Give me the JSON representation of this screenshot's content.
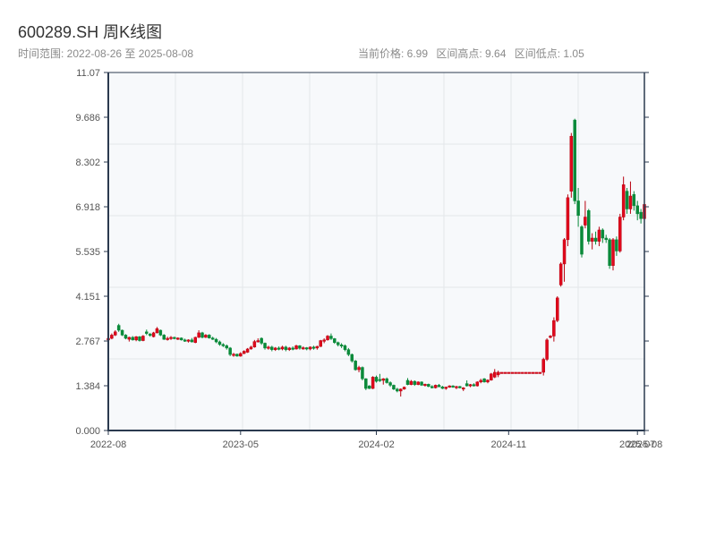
{
  "header": {
    "title": "600289.SH 周K线图",
    "range_text": "时间范围: 2022-08-26 至 2025-08-08",
    "current_price": "当前价格: 6.99",
    "range_high": "区间高点: 9.64",
    "range_low": "区间低点: 1.05"
  },
  "chart_data": {
    "type": "candlestick",
    "title": "600289.SH 周K线图",
    "xlabel": "",
    "ylabel": "",
    "frequency": "weekly",
    "date_range": [
      "2022-08-26",
      "2025-08-08"
    ],
    "ylim": [
      0,
      11.07
    ],
    "y_ticks": [
      "0.000",
      "1.384",
      "2.767",
      "4.151",
      "5.535",
      "6.918",
      "8.302",
      "9.686",
      "11.07"
    ],
    "x_ticks": [
      {
        "label": "2022-08",
        "index": 0
      },
      {
        "label": "2023-05",
        "index": 38
      },
      {
        "label": "2024-02",
        "index": 77
      },
      {
        "label": "2024-11",
        "index": 115
      },
      {
        "label": "2025-07",
        "index": 152
      },
      {
        "label": "2025-08",
        "index": 154
      }
    ],
    "grid": true,
    "colors": {
      "up": "#e0081c",
      "up_border": "#b8000f",
      "down": "#0a8a3a",
      "axis": "#2b3a4f",
      "grid": "#e3e6ea",
      "plot_bg": "#f7f9fb"
    },
    "ohlc_fields": [
      "open",
      "high",
      "low",
      "close"
    ],
    "ohlc": [
      [
        2.8,
        2.9,
        2.78,
        2.85
      ],
      [
        2.85,
        3.0,
        2.82,
        2.95
      ],
      [
        2.95,
        3.1,
        2.92,
        3.05
      ],
      [
        3.25,
        3.3,
        3.05,
        3.1
      ],
      [
        3.1,
        3.12,
        2.92,
        2.95
      ],
      [
        2.95,
        2.98,
        2.82,
        2.85
      ],
      [
        2.82,
        2.9,
        2.75,
        2.88
      ],
      [
        2.88,
        2.92,
        2.78,
        2.8
      ],
      [
        2.8,
        2.92,
        2.76,
        2.9
      ],
      [
        2.9,
        2.92,
        2.75,
        2.78
      ],
      [
        2.78,
        2.95,
        2.76,
        2.92
      ],
      [
        3.05,
        3.12,
        2.95,
        3.0
      ],
      [
        2.98,
        3.02,
        2.9,
        2.95
      ],
      [
        2.9,
        3.05,
        2.88,
        3.02
      ],
      [
        3.02,
        3.2,
        3.0,
        3.15
      ],
      [
        3.1,
        3.12,
        2.92,
        2.95
      ],
      [
        2.95,
        2.98,
        2.8,
        2.82
      ],
      [
        2.82,
        2.9,
        2.78,
        2.85
      ],
      [
        2.85,
        2.92,
        2.8,
        2.88
      ],
      [
        2.88,
        2.9,
        2.82,
        2.84
      ],
      [
        2.84,
        2.88,
        2.8,
        2.86
      ],
      [
        2.86,
        2.88,
        2.78,
        2.8
      ],
      [
        2.8,
        2.84,
        2.74,
        2.76
      ],
      [
        2.76,
        2.82,
        2.72,
        2.8
      ],
      [
        2.8,
        2.86,
        2.72,
        2.74
      ],
      [
        2.72,
        2.9,
        2.7,
        2.88
      ],
      [
        2.88,
        3.1,
        2.86,
        3.02
      ],
      [
        3.02,
        3.05,
        2.85,
        2.88
      ],
      [
        2.88,
        2.98,
        2.86,
        2.95
      ],
      [
        2.95,
        2.98,
        2.84,
        2.86
      ],
      [
        2.86,
        2.9,
        2.8,
        2.82
      ],
      [
        2.82,
        2.86,
        2.7,
        2.74
      ],
      [
        2.74,
        2.78,
        2.62,
        2.66
      ],
      [
        2.66,
        2.7,
        2.58,
        2.62
      ],
      [
        2.62,
        2.66,
        2.5,
        2.55
      ],
      [
        2.55,
        2.58,
        2.3,
        2.35
      ],
      [
        2.32,
        2.4,
        2.28,
        2.36
      ],
      [
        2.36,
        2.38,
        2.28,
        2.3
      ],
      [
        2.3,
        2.42,
        2.28,
        2.38
      ],
      [
        2.38,
        2.48,
        2.36,
        2.45
      ],
      [
        2.42,
        2.55,
        2.4,
        2.52
      ],
      [
        2.52,
        2.62,
        2.5,
        2.58
      ],
      [
        2.58,
        2.8,
        2.56,
        2.75
      ],
      [
        2.75,
        2.85,
        2.72,
        2.78
      ],
      [
        2.85,
        2.88,
        2.65,
        2.7
      ],
      [
        2.7,
        2.72,
        2.5,
        2.55
      ],
      [
        2.55,
        2.62,
        2.5,
        2.58
      ],
      [
        2.58,
        2.62,
        2.45,
        2.5
      ],
      [
        2.5,
        2.58,
        2.46,
        2.55
      ],
      [
        2.55,
        2.6,
        2.48,
        2.52
      ],
      [
        2.52,
        2.62,
        2.48,
        2.58
      ],
      [
        2.58,
        2.62,
        2.45,
        2.5
      ],
      [
        2.5,
        2.58,
        2.46,
        2.55
      ],
      [
        2.55,
        2.6,
        2.48,
        2.52
      ],
      [
        2.52,
        2.65,
        2.5,
        2.62
      ],
      [
        2.62,
        2.64,
        2.5,
        2.54
      ],
      [
        2.54,
        2.6,
        2.5,
        2.56
      ],
      [
        2.56,
        2.58,
        2.48,
        2.52
      ],
      [
        2.52,
        2.6,
        2.48,
        2.58
      ],
      [
        2.58,
        2.62,
        2.5,
        2.55
      ],
      [
        2.55,
        2.62,
        2.5,
        2.6
      ],
      [
        2.6,
        2.8,
        2.58,
        2.78
      ],
      [
        2.78,
        2.85,
        2.7,
        2.8
      ],
      [
        2.8,
        2.95,
        2.78,
        2.92
      ],
      [
        2.92,
        3.0,
        2.8,
        2.84
      ],
      [
        2.84,
        2.86,
        2.68,
        2.72
      ],
      [
        2.72,
        2.75,
        2.6,
        2.65
      ],
      [
        2.65,
        2.7,
        2.55,
        2.62
      ],
      [
        2.62,
        2.66,
        2.45,
        2.5
      ],
      [
        2.5,
        2.55,
        2.3,
        2.35
      ],
      [
        2.35,
        2.38,
        2.1,
        2.15
      ],
      [
        2.15,
        2.18,
        1.85,
        1.88
      ],
      [
        1.88,
        2.0,
        1.8,
        1.95
      ],
      [
        1.95,
        1.98,
        1.55,
        1.6
      ],
      [
        1.6,
        1.62,
        1.25,
        1.3
      ],
      [
        1.38,
        1.4,
        1.28,
        1.3
      ],
      [
        1.3,
        1.68,
        1.28,
        1.65
      ],
      [
        1.65,
        1.7,
        1.48,
        1.52
      ],
      [
        1.58,
        1.75,
        1.5,
        1.55
      ],
      [
        1.55,
        1.62,
        1.42,
        1.6
      ],
      [
        1.6,
        1.64,
        1.45,
        1.48
      ],
      [
        1.48,
        1.52,
        1.35,
        1.4
      ],
      [
        1.4,
        1.42,
        1.25,
        1.28
      ],
      [
        1.28,
        1.32,
        1.18,
        1.22
      ],
      [
        1.22,
        1.3,
        1.05,
        1.28
      ],
      [
        1.28,
        1.36,
        1.26,
        1.34
      ],
      [
        1.55,
        1.62,
        1.4,
        1.42
      ],
      [
        1.42,
        1.56,
        1.4,
        1.52
      ],
      [
        1.52,
        1.55,
        1.38,
        1.42
      ],
      [
        1.42,
        1.52,
        1.4,
        1.5
      ],
      [
        1.5,
        1.52,
        1.38,
        1.4
      ],
      [
        1.4,
        1.45,
        1.36,
        1.43
      ],
      [
        1.43,
        1.45,
        1.34,
        1.36
      ],
      [
        1.36,
        1.4,
        1.3,
        1.32
      ],
      [
        1.32,
        1.42,
        1.3,
        1.4
      ],
      [
        1.4,
        1.44,
        1.34,
        1.35
      ],
      [
        1.35,
        1.38,
        1.28,
        1.3
      ],
      [
        1.3,
        1.36,
        1.26,
        1.34
      ],
      [
        1.34,
        1.4,
        1.32,
        1.38
      ],
      [
        1.38,
        1.4,
        1.32,
        1.34
      ],
      [
        1.34,
        1.38,
        1.28,
        1.36
      ],
      [
        1.36,
        1.38,
        1.3,
        1.32
      ],
      [
        1.28,
        1.34,
        1.22,
        1.32
      ],
      [
        1.45,
        1.55,
        1.36,
        1.38
      ],
      [
        1.38,
        1.44,
        1.34,
        1.42
      ],
      [
        1.42,
        1.46,
        1.36,
        1.38
      ],
      [
        1.38,
        1.52,
        1.36,
        1.5
      ],
      [
        1.5,
        1.6,
        1.46,
        1.55
      ],
      [
        1.6,
        1.62,
        1.48,
        1.5
      ],
      [
        1.5,
        1.58,
        1.46,
        1.56
      ],
      [
        1.56,
        1.78,
        1.54,
        1.75
      ],
      [
        1.65,
        1.9,
        1.62,
        1.8
      ],
      [
        1.72,
        1.85,
        1.65,
        1.8
      ],
      [
        1.8,
        1.8,
        1.8,
        1.8
      ],
      [
        1.8,
        1.8,
        1.8,
        1.8
      ],
      [
        1.8,
        1.8,
        1.8,
        1.8
      ],
      [
        1.8,
        1.8,
        1.8,
        1.8
      ],
      [
        1.8,
        1.8,
        1.8,
        1.8
      ],
      [
        1.8,
        1.8,
        1.8,
        1.8
      ],
      [
        1.8,
        1.8,
        1.8,
        1.8
      ],
      [
        1.8,
        1.8,
        1.8,
        1.8
      ],
      [
        1.8,
        1.8,
        1.8,
        1.8
      ],
      [
        1.8,
        1.8,
        1.8,
        1.8
      ],
      [
        1.8,
        1.8,
        1.8,
        1.8
      ],
      [
        1.8,
        1.8,
        1.8,
        1.8
      ],
      [
        1.8,
        2.25,
        1.7,
        2.2
      ],
      [
        2.2,
        2.85,
        2.15,
        2.8
      ],
      [
        2.88,
        2.95,
        2.85,
        2.92
      ],
      [
        2.92,
        3.5,
        2.75,
        3.4
      ],
      [
        3.4,
        4.15,
        3.35,
        4.1
      ],
      [
        4.5,
        5.2,
        4.45,
        5.15
      ],
      [
        5.15,
        5.95,
        4.6,
        5.9
      ],
      [
        5.9,
        7.3,
        5.7,
        7.2
      ],
      [
        7.4,
        9.2,
        7.2,
        9.1
      ],
      [
        9.6,
        9.64,
        7.0,
        7.1
      ],
      [
        7.1,
        7.5,
        6.3,
        6.65
      ],
      [
        6.3,
        6.35,
        5.35,
        5.45
      ],
      [
        6.35,
        7.1,
        6.25,
        6.6
      ],
      [
        6.8,
        6.85,
        5.75,
        5.85
      ],
      [
        5.85,
        6.1,
        5.6,
        5.95
      ],
      [
        5.95,
        6.15,
        5.75,
        5.85
      ],
      [
        5.85,
        6.3,
        5.7,
        6.2
      ],
      [
        6.2,
        6.25,
        5.8,
        5.95
      ],
      [
        5.95,
        6.05,
        5.8,
        5.9
      ],
      [
        5.9,
        5.95,
        5.0,
        5.1
      ],
      [
        5.1,
        5.95,
        4.95,
        5.9
      ],
      [
        5.9,
        6.0,
        5.4,
        5.55
      ],
      [
        5.55,
        6.7,
        5.5,
        6.6
      ],
      [
        6.6,
        7.85,
        6.5,
        7.6
      ],
      [
        7.4,
        7.5,
        6.7,
        6.85
      ],
      [
        6.85,
        7.7,
        6.7,
        7.25
      ],
      [
        7.3,
        7.4,
        6.8,
        6.95
      ],
      [
        6.95,
        7.1,
        6.5,
        6.7
      ],
      [
        6.75,
        6.85,
        6.4,
        6.55
      ],
      [
        6.55,
        7.1,
        6.5,
        6.99
      ]
    ]
  }
}
